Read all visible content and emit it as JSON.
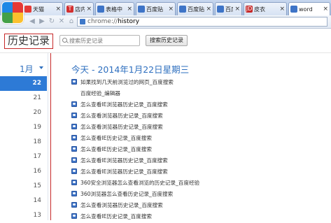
{
  "tabs": [
    {
      "label": "天猫",
      "favicon": "tmall-icon",
      "color": "#e53935",
      "active": false
    },
    {
      "label": "店内所",
      "favicon": "t-icon",
      "color": "#d32f2f",
      "active": false
    },
    {
      "label": "表格中",
      "favicon": "baidu-paw-icon",
      "color": "#3e74c7",
      "active": false
    },
    {
      "label": "百度贴",
      "favicon": "baidu-paw-icon",
      "color": "#3e74c7",
      "active": false
    },
    {
      "label": "百度贴",
      "favicon": "baidu-paw-icon",
      "color": "#3e74c7",
      "active": false
    },
    {
      "label": "百度贴",
      "favicon": "baidu-paw-icon",
      "color": "#3e74c7",
      "active": false
    },
    {
      "label": "皮衣",
      "favicon": "jd-icon",
      "color": "#c62828",
      "active": false
    },
    {
      "label": "word",
      "favicon": "baidu-paw-icon",
      "color": "#3e74c7",
      "active": true
    }
  ],
  "jd_badge": "JD",
  "t_badge": "T",
  "close_glyph": "×",
  "address": {
    "scheme": "chrome://",
    "path": "history"
  },
  "history": {
    "title": "历史记录",
    "search_placeholder": "搜索历史记录",
    "search_button": "搜索历史记录",
    "month": "1月",
    "days": [
      "22",
      "21",
      "20",
      "19",
      "18",
      "17",
      "16",
      "15",
      "14",
      "13"
    ],
    "selected_day": "22",
    "date_heading": "今天 - 2014年1月22日星期三",
    "entries": [
      {
        "text": "如果找到几天前浏览过的网页_百度搜索",
        "icon": true
      },
      {
        "text": "百度经验_编辑器",
        "icon": false
      },
      {
        "text": "怎么查看IE浏览器历史记录_百度搜索",
        "icon": true
      },
      {
        "text": "怎么查看浏览器历史记录_百度搜索",
        "icon": true
      },
      {
        "text": "怎么查看浏览器历史记录_百度搜索",
        "icon": true
      },
      {
        "text": "怎么查看IE历史记录_百度搜索",
        "icon": true
      },
      {
        "text": "怎么查看IE历史记录_百度搜索",
        "icon": true
      },
      {
        "text": "怎么查看IE浏览器历史记录_百度搜索",
        "icon": true
      },
      {
        "text": "怎么查看IE浏览器历史记录_百度搜索",
        "icon": true
      },
      {
        "text": "360安全浏览器怎么查看浏览的历史记录_百度经验",
        "icon": true
      },
      {
        "text": "360浏览器怎么查看历史记录_百度搜索",
        "icon": true
      },
      {
        "text": "怎么查看浏览器历史记录_百度搜索",
        "icon": true
      },
      {
        "text": "怎么查看IE历史记录_百度搜索",
        "icon": true
      }
    ]
  }
}
